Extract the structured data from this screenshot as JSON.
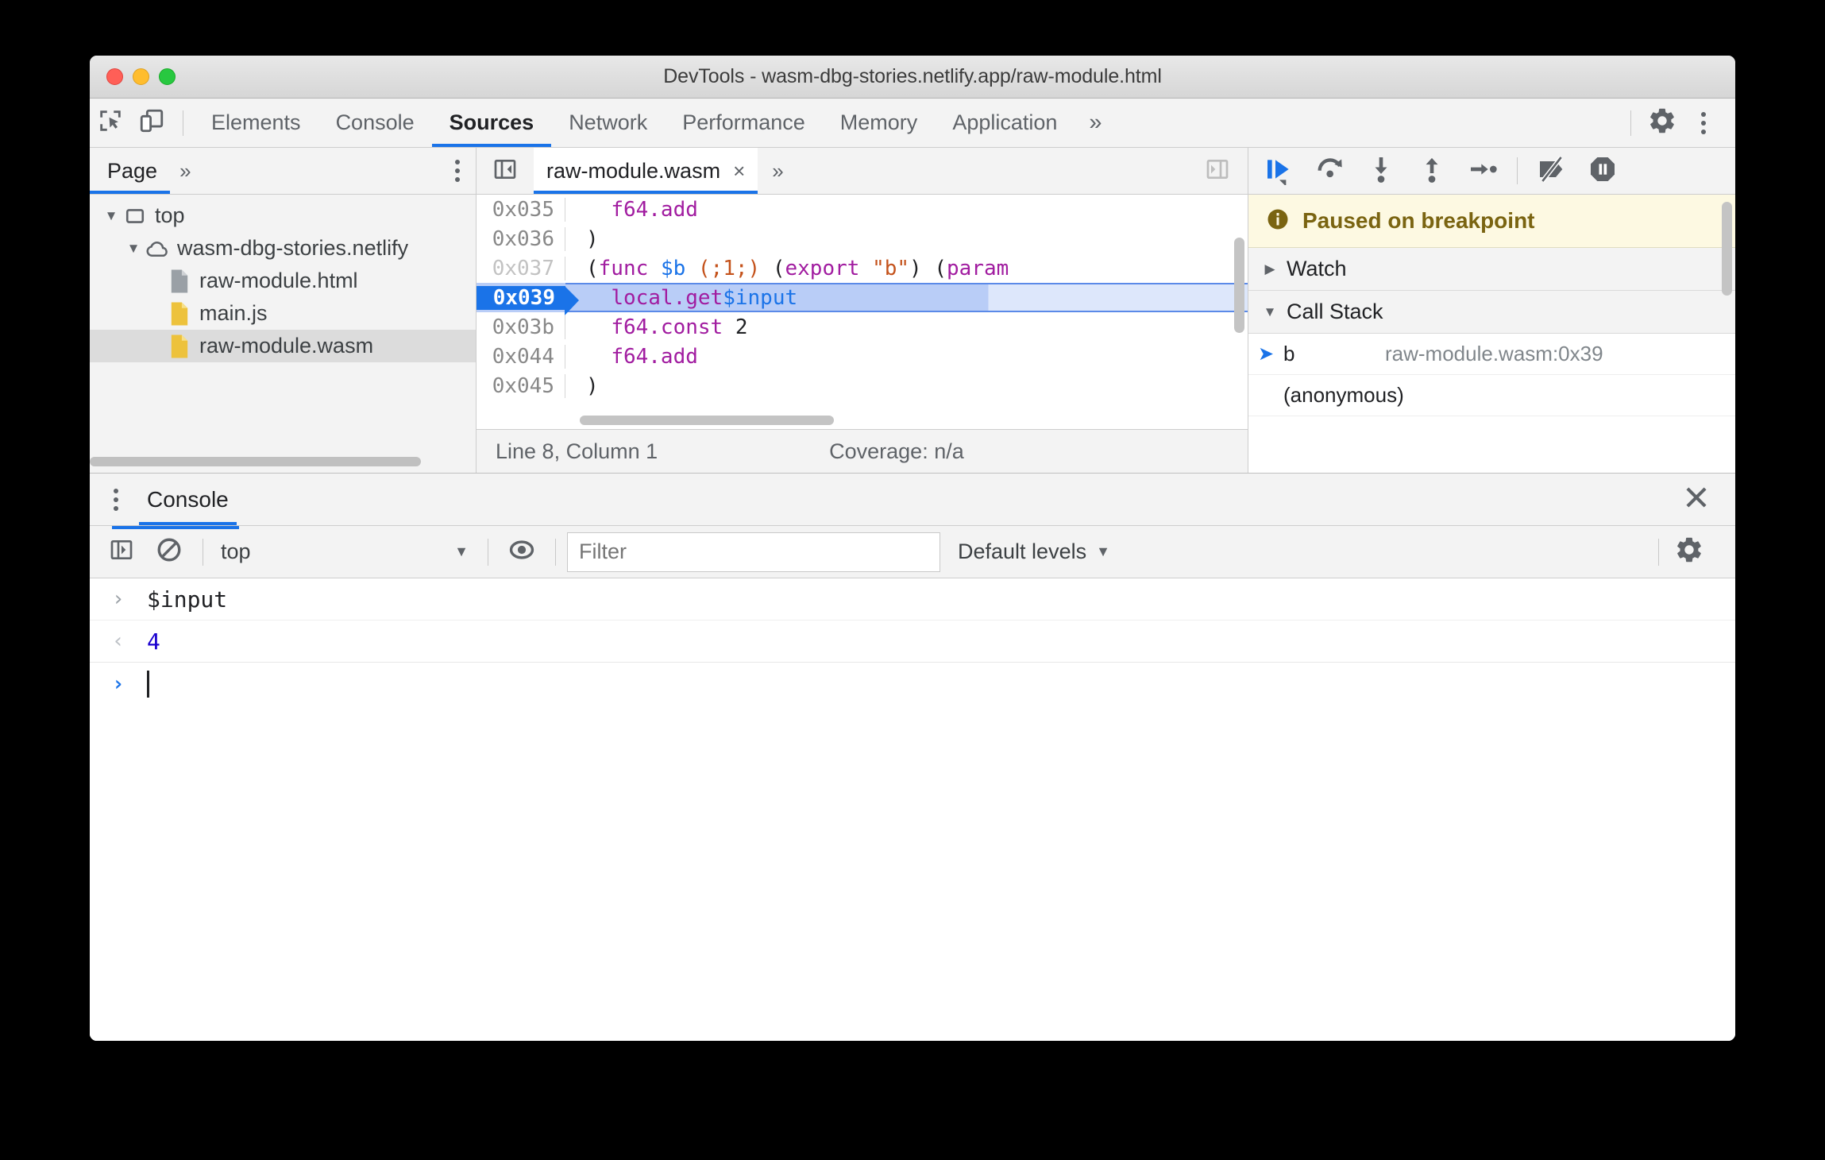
{
  "window": {
    "title": "DevTools - wasm-dbg-stories.netlify.app/raw-module.html",
    "traffic_lights": [
      "close",
      "minimize",
      "maximize"
    ]
  },
  "devtools_tabs": {
    "inspect_icon": "inspect-element-icon",
    "device_icon": "device-toolbar-icon",
    "items": [
      {
        "label": "Elements",
        "active": false
      },
      {
        "label": "Console",
        "active": false
      },
      {
        "label": "Sources",
        "active": true
      },
      {
        "label": "Network",
        "active": false
      },
      {
        "label": "Performance",
        "active": false
      },
      {
        "label": "Memory",
        "active": false
      },
      {
        "label": "Application",
        "active": false
      }
    ],
    "overflow_label": "»",
    "settings_icon": "gear-icon",
    "main_menu_icon": "kebab-menu-icon"
  },
  "navigator": {
    "tab_label": "Page",
    "overflow_label": "»",
    "menu_icon": "kebab-menu-icon",
    "tree": [
      {
        "label": "top",
        "icon": "frame-icon",
        "indent": 0,
        "twisty": "down",
        "selected": false
      },
      {
        "label": "wasm-dbg-stories.netlify",
        "icon": "cloud-icon",
        "indent": 1,
        "twisty": "down",
        "selected": false
      },
      {
        "label": "raw-module.html",
        "icon": "file-grey-icon",
        "indent": 2,
        "twisty": "none",
        "selected": false
      },
      {
        "label": "main.js",
        "icon": "file-yellow-icon",
        "indent": 2,
        "twisty": "none",
        "selected": false
      },
      {
        "label": "raw-module.wasm",
        "icon": "file-yellow-icon",
        "indent": 2,
        "twisty": "none",
        "selected": true
      }
    ]
  },
  "editor": {
    "show_navigator_icon": "show-navigator-icon",
    "show_debugger_icon": "show-debugger-icon",
    "tab_name": "raw-module.wasm",
    "tab_close": "×",
    "tab_overflow": "»",
    "lines": [
      {
        "addr": "0x035",
        "dim": false,
        "current": false,
        "tokens": [
          {
            "t": "  ",
            "c": "pl"
          },
          {
            "t": "f64.add",
            "c": "op"
          }
        ]
      },
      {
        "addr": "0x036",
        "dim": false,
        "current": false,
        "tokens": [
          {
            "t": ")",
            "c": "pl"
          }
        ]
      },
      {
        "addr": "0x037",
        "dim": true,
        "current": false,
        "tokens": [
          {
            "t": "(",
            "c": "pl"
          },
          {
            "t": "func",
            "c": "def"
          },
          {
            "t": " ",
            "c": "pl"
          },
          {
            "t": "$b",
            "c": "var"
          },
          {
            "t": " ",
            "c": "pl"
          },
          {
            "t": "(;1;)",
            "c": "cmt"
          },
          {
            "t": " ",
            "c": "pl"
          },
          {
            "t": "(",
            "c": "pl"
          },
          {
            "t": "export",
            "c": "def"
          },
          {
            "t": " ",
            "c": "pl"
          },
          {
            "t": "\"b\"",
            "c": "cmt"
          },
          {
            "t": ")",
            "c": "pl"
          },
          {
            "t": " ",
            "c": "pl"
          },
          {
            "t": "(",
            "c": "pl"
          },
          {
            "t": "param",
            "c": "def"
          }
        ]
      },
      {
        "addr": "0x039",
        "dim": false,
        "current": true,
        "tokens": [
          {
            "t": "  ",
            "c": "pl"
          },
          {
            "t": "local.get",
            "c": "op"
          },
          {
            "t": " ",
            "c": "pl"
          },
          {
            "t": "$input",
            "c": "var"
          }
        ]
      },
      {
        "addr": "0x03b",
        "dim": false,
        "current": false,
        "tokens": [
          {
            "t": "  ",
            "c": "pl"
          },
          {
            "t": "f64.const",
            "c": "op"
          },
          {
            "t": " ",
            "c": "pl"
          },
          {
            "t": "2",
            "c": "num"
          }
        ]
      },
      {
        "addr": "0x044",
        "dim": false,
        "current": false,
        "tokens": [
          {
            "t": "  ",
            "c": "pl"
          },
          {
            "t": "f64.add",
            "c": "op"
          }
        ]
      },
      {
        "addr": "0x045",
        "dim": false,
        "current": false,
        "tokens": [
          {
            "t": ")",
            "c": "pl"
          }
        ]
      }
    ],
    "status_line": "Line 8, Column 1",
    "status_coverage": "Coverage: n/a"
  },
  "debugger": {
    "toolbar": [
      {
        "name": "resume-script-execution-button",
        "icon": "resume-icon",
        "active": true
      },
      {
        "name": "step-over-button",
        "icon": "step-over-icon",
        "active": false
      },
      {
        "name": "step-into-button",
        "icon": "step-into-icon",
        "active": false
      },
      {
        "name": "step-out-button",
        "icon": "step-out-icon",
        "active": false
      },
      {
        "name": "step-button",
        "icon": "step-icon",
        "active": false
      },
      {
        "name": "deactivate-breakpoints-button",
        "icon": "deactivate-breakpoints-icon",
        "active": false
      },
      {
        "name": "pause-on-exceptions-button",
        "icon": "pause-on-exceptions-icon",
        "active": false
      }
    ],
    "paused_banner": {
      "icon": "info-icon",
      "text": "Paused on breakpoint"
    },
    "watch": {
      "label": "Watch",
      "expanded": false
    },
    "call_stack": {
      "label": "Call Stack",
      "expanded": true,
      "frames": [
        {
          "name": "b",
          "location": "raw-module.wasm:0x39",
          "selected": true
        },
        {
          "name": "(anonymous)",
          "location": "",
          "selected": false
        }
      ]
    }
  },
  "drawer": {
    "menu_icon": "kebab-menu-icon",
    "tab_label": "Console",
    "close_icon": "close-icon",
    "toolbar": {
      "sidebar_icon": "console-sidebar-icon",
      "clear_icon": "clear-console-icon",
      "context": "top",
      "context_caret": "▼",
      "eye_icon": "live-expression-icon",
      "filter_placeholder": "Filter",
      "filter_value": "",
      "levels_label": "Default levels",
      "levels_caret": "▼",
      "settings_icon": "gear-icon"
    },
    "messages": [
      {
        "kind": "input",
        "marker": "›",
        "text": "$input"
      },
      {
        "kind": "result",
        "marker": "‹",
        "text": "4"
      },
      {
        "kind": "prompt",
        "marker": "›",
        "text": ""
      }
    ]
  },
  "colors": {
    "accent": "#1a73e8",
    "paused_bg": "#fdf9e2",
    "paused_text": "#7a6411",
    "result_value": "#1a00cf",
    "keyword": "#a11ca0",
    "variable": "#1a73e8",
    "comment": "#c4521b"
  }
}
